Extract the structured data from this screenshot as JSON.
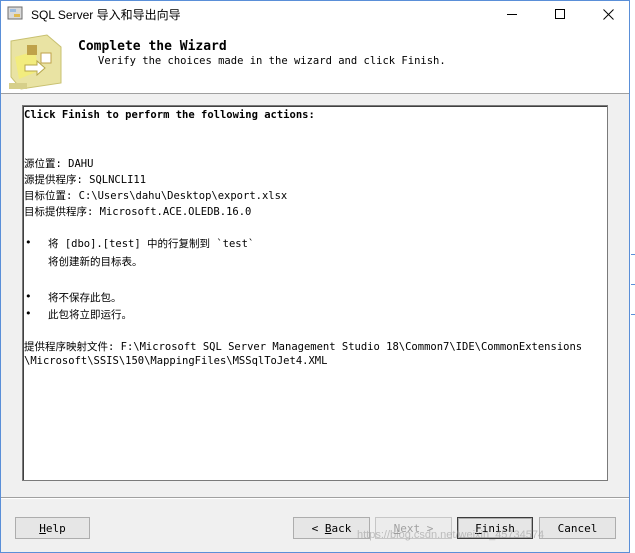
{
  "window": {
    "title": "SQL Server 导入和导出向导"
  },
  "header": {
    "title": "Complete the Wizard",
    "subtitle": "Verify the choices made in the wizard and click Finish."
  },
  "summary": {
    "intro": "Click Finish to perform the following actions:",
    "source_location": "源位置: DAHU",
    "source_provider": "源提供程序: SQLNCLI11",
    "target_location": "目标位置: C:\\Users\\dahu\\Desktop\\export.xlsx",
    "target_provider": "目标提供程序: Microsoft.ACE.OLEDB.16.0",
    "bullet_copy": "将 [dbo].[test] 中的行复制到 `test`",
    "bullet_copy_sub": "将创建新的目标表。",
    "bullet_no_save": "将不保存此包。",
    "bullet_run": "此包将立即运行。",
    "mapping_line1": "提供程序映射文件: F:\\Microsoft SQL Server Management Studio 18\\Common7\\IDE\\CommonExtensions",
    "mapping_line2": "\\Microsoft\\SSIS\\150\\MappingFiles\\MSSqlToJet4.XML"
  },
  "buttons": {
    "help": {
      "mnemonic": "H",
      "rest": "elp"
    },
    "back": {
      "prefix": "< ",
      "mnemonic": "B",
      "rest": "ack"
    },
    "next": {
      "mnemonic": "N",
      "rest": "ext >"
    },
    "finish": {
      "mnemonic": "F",
      "rest": "inish"
    },
    "cancel": {
      "label": "Cancel"
    }
  },
  "watermark": "https://blog.csdn.net/weixin_45734574",
  "colors": {
    "window_border": "#5a8fd8",
    "dialog_bg": "#f0f0f0",
    "button_bg": "#e6e6e6"
  }
}
